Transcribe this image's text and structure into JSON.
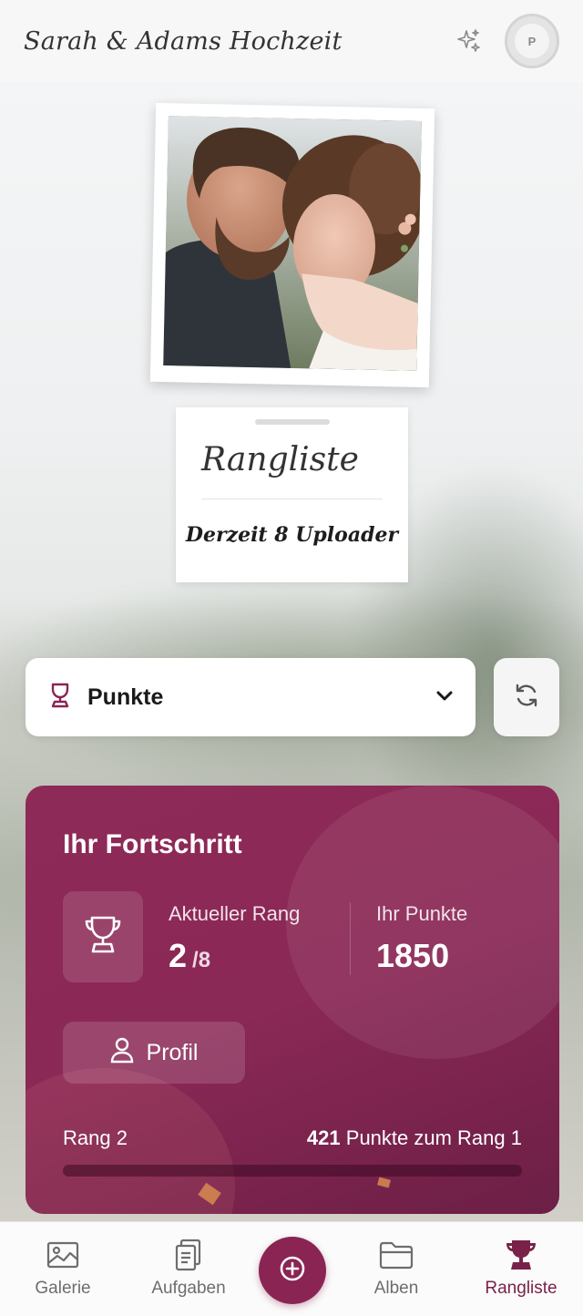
{
  "header": {
    "title": "Sarah & Adams Hochzeit",
    "avatar_initial": "P"
  },
  "title_card": {
    "heading": "Rangliste",
    "subtitle": "Derzeit 8 Uploader"
  },
  "sort_select": {
    "selected": "Punkte",
    "icon": "trophy-icon"
  },
  "progress": {
    "title": "Ihr Fortschritt",
    "rank_label": "Aktueller Rang",
    "rank_value": "2",
    "rank_total": "/8",
    "points_label": "Ihr Punkte",
    "points_value": "1850",
    "profile_button": "Profil",
    "current_rank_text": "Rang 2",
    "points_needed": "421",
    "points_needed_suffix": "Punkte zum Rang 1",
    "progress_fraction": 0.0
  },
  "nav": {
    "items": [
      {
        "label": "Galerie",
        "icon": "gallery-icon"
      },
      {
        "label": "Aufgaben",
        "icon": "tasks-icon"
      },
      {
        "label": "Alben",
        "icon": "folder-icon"
      },
      {
        "label": "Rangliste",
        "icon": "trophy-icon"
      }
    ],
    "active": "Rangliste"
  },
  "colors": {
    "accent": "#8a2553",
    "card_gradient_start": "#8e2a57",
    "card_gradient_end": "#6c1f45"
  }
}
